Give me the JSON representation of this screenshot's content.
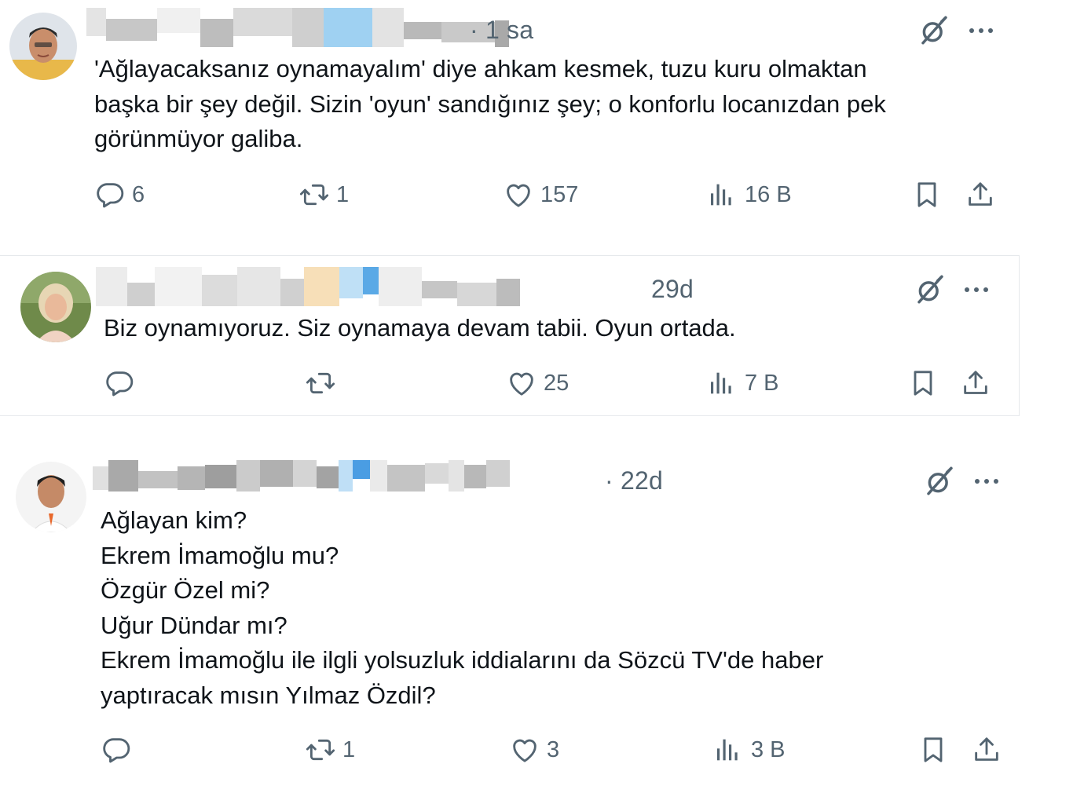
{
  "colors": {
    "text": "#0f1419",
    "muted": "#536471",
    "border": "#e6e9ec"
  },
  "posts": [
    {
      "time": "· 1 sa",
      "lines": [
        "'Ağlayacaksanız oynamayalım' diye ahkam kesmek, tuzu kuru olmaktan",
        "başka bir şey değil. Sizin 'oyun' sandığınız şey; o konforlu locanızdan pek",
        "görünmüyor galiba."
      ],
      "replies": "6",
      "reposts": "1",
      "likes": "157",
      "views": "16 B"
    },
    {
      "time": "29d",
      "lines": [
        "Biz oynamıyoruz. Siz oynamaya devam tabii. Oyun ortada."
      ],
      "replies": "",
      "reposts": "",
      "likes": "25",
      "views": "7 B"
    },
    {
      "time": "· 22d",
      "lines": [
        "Ağlayan kim?",
        "Ekrem İmamoğlu mu?",
        "Özgür Özel mi?",
        "Uğur Dündar mı?",
        "Ekrem İmamoğlu ile ilgli yolsuzluk iddialarını da Sözcü TV'de haber",
        "yaptıracak mısın Yılmaz Özdil?"
      ],
      "replies": "",
      "reposts": "1",
      "likes": "3",
      "views": "3 B"
    }
  ],
  "icons": {
    "reply": "reply-icon",
    "repost": "repost-icon",
    "like": "heart-icon",
    "views": "views-icon",
    "bookmark": "bookmark-icon",
    "share": "share-icon",
    "grok": "grok-icon",
    "more": "more-icon"
  }
}
